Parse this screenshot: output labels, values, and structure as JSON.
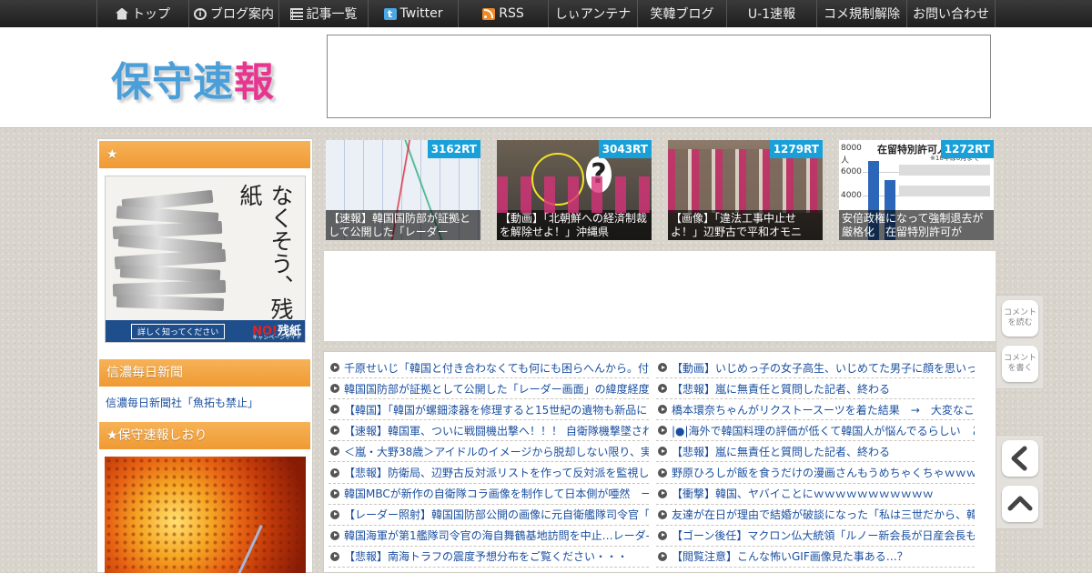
{
  "nav": {
    "items": [
      {
        "label": "トップ",
        "icon": "home-icon"
      },
      {
        "label": "ブログ案内",
        "icon": "info-icon"
      },
      {
        "label": "記事一覧",
        "icon": "list-icon"
      },
      {
        "label": "Twitter",
        "icon": "twitter-icon"
      },
      {
        "label": "RSS",
        "icon": "rss-icon"
      },
      {
        "label": "しぃアンテナ"
      },
      {
        "label": "笑韓ブログ"
      },
      {
        "label": "U-1速報"
      },
      {
        "label": "コメ規制解除"
      },
      {
        "label": "お問い合わせ"
      }
    ]
  },
  "header": {
    "logo_chars": [
      "保",
      "守",
      "速",
      "報"
    ]
  },
  "sidebar": {
    "section1_title": "★",
    "banner": {
      "headline": "なくそう、残紙",
      "button": "詳しく知ってください",
      "campaign_no": "NO!",
      "campaign_word": "残紙",
      "campaign_sub": "キャンペーンサイト"
    },
    "section2_title": "信濃毎日新聞",
    "section2_link": "信濃毎日新聞社「魚拓も禁止」",
    "section3_title": "★保守速報しおり"
  },
  "thumbs": [
    {
      "rt": "3162RT",
      "caption": "【速報】韓国国防部が証拠として公開した「レーダー"
    },
    {
      "rt": "3043RT",
      "caption": "【動画】「北朝鮮への経済制裁を解除せよ！」沖縄県"
    },
    {
      "rt": "1279RT",
      "caption": "【画像】「違法工事中止せよ！」辺野古で平和オモニ"
    },
    {
      "rt": "1272RT",
      "caption": "安倍政権になって強制退去が厳格化　在留特別許可が",
      "chart_title": "在留特別許可人数",
      "chart_sub": "※18年は6月まで",
      "y_labels": [
        "8000",
        "6000",
        "4000"
      ],
      "y_unit": "人"
    }
  ],
  "headlines_left": [
    "千原せいじ「韓国と付き合わなくても何にも困らへんから。付",
    "韓国国防部が証拠として公開した「レーダー画面」の緯度経度",
    "【韓国】「韓国が螺鈿漆器を修理すると15世紀の遺物も新品に",
    "【速報】韓国軍、ついに戦闘機出撃へ！！！ 自衛隊機撃墜され",
    "＜嵐・大野38歳＞アイドルのイメージから脱却しない限り、実",
    "【悲報】防衛局、辺野古反対派リストを作って反対派を監視し",
    "韓国MBCが新作の自衛隊コラ画像を制作して日本側が唖然　ー",
    "【レーダー照射】韓国国防部公開の画像に元自衛艦隊司令官「",
    "韓国海軍が第1艦隊司令官の海自舞鶴基地訪問を中止…レーダ-",
    "【悲報】南海トラフの震度予想分布をご覧ください・・・"
  ],
  "headlines_right": [
    "【動画】いじめっ子の女子高生、いじめてた男子に顔を思いっ",
    "【悲報】嵐に無責任と質問した記者、終わる",
    "橋本環奈ちゃんがリクストースーツを着た結果　→　大変なこ",
    "|●|海外で韓国料理の評価が低くて韓国人が悩んでるらしい　ど",
    "【悲報】嵐に無責任と質問した記者、終わる",
    "野原ひろしが飯を食うだけの漫画さんもうめちゃくちゃｗｗｗ",
    "【衝撃】韓国、ヤバイことにｗｗｗｗｗｗｗｗｗｗｗ",
    "友達が在日が理由で結婚が破談になった「私は三世だから、韓",
    "【ゴーン後任】マクロン仏大統領「ルノー新会長が日産会長も",
    "【閲覧注意】こんな怖いGIF画像見た事ある…？"
  ],
  "float": {
    "read_comments": "コメント\nを読む",
    "write_comment": "コメント\nを書く"
  },
  "colors": {
    "accent_orange": "#ef9a33",
    "rt_badge": "#1aa0d8",
    "link_blue": "#1a4fa0",
    "logo_blue": "#4a9fd8",
    "logo_pink": "#e8368f"
  }
}
